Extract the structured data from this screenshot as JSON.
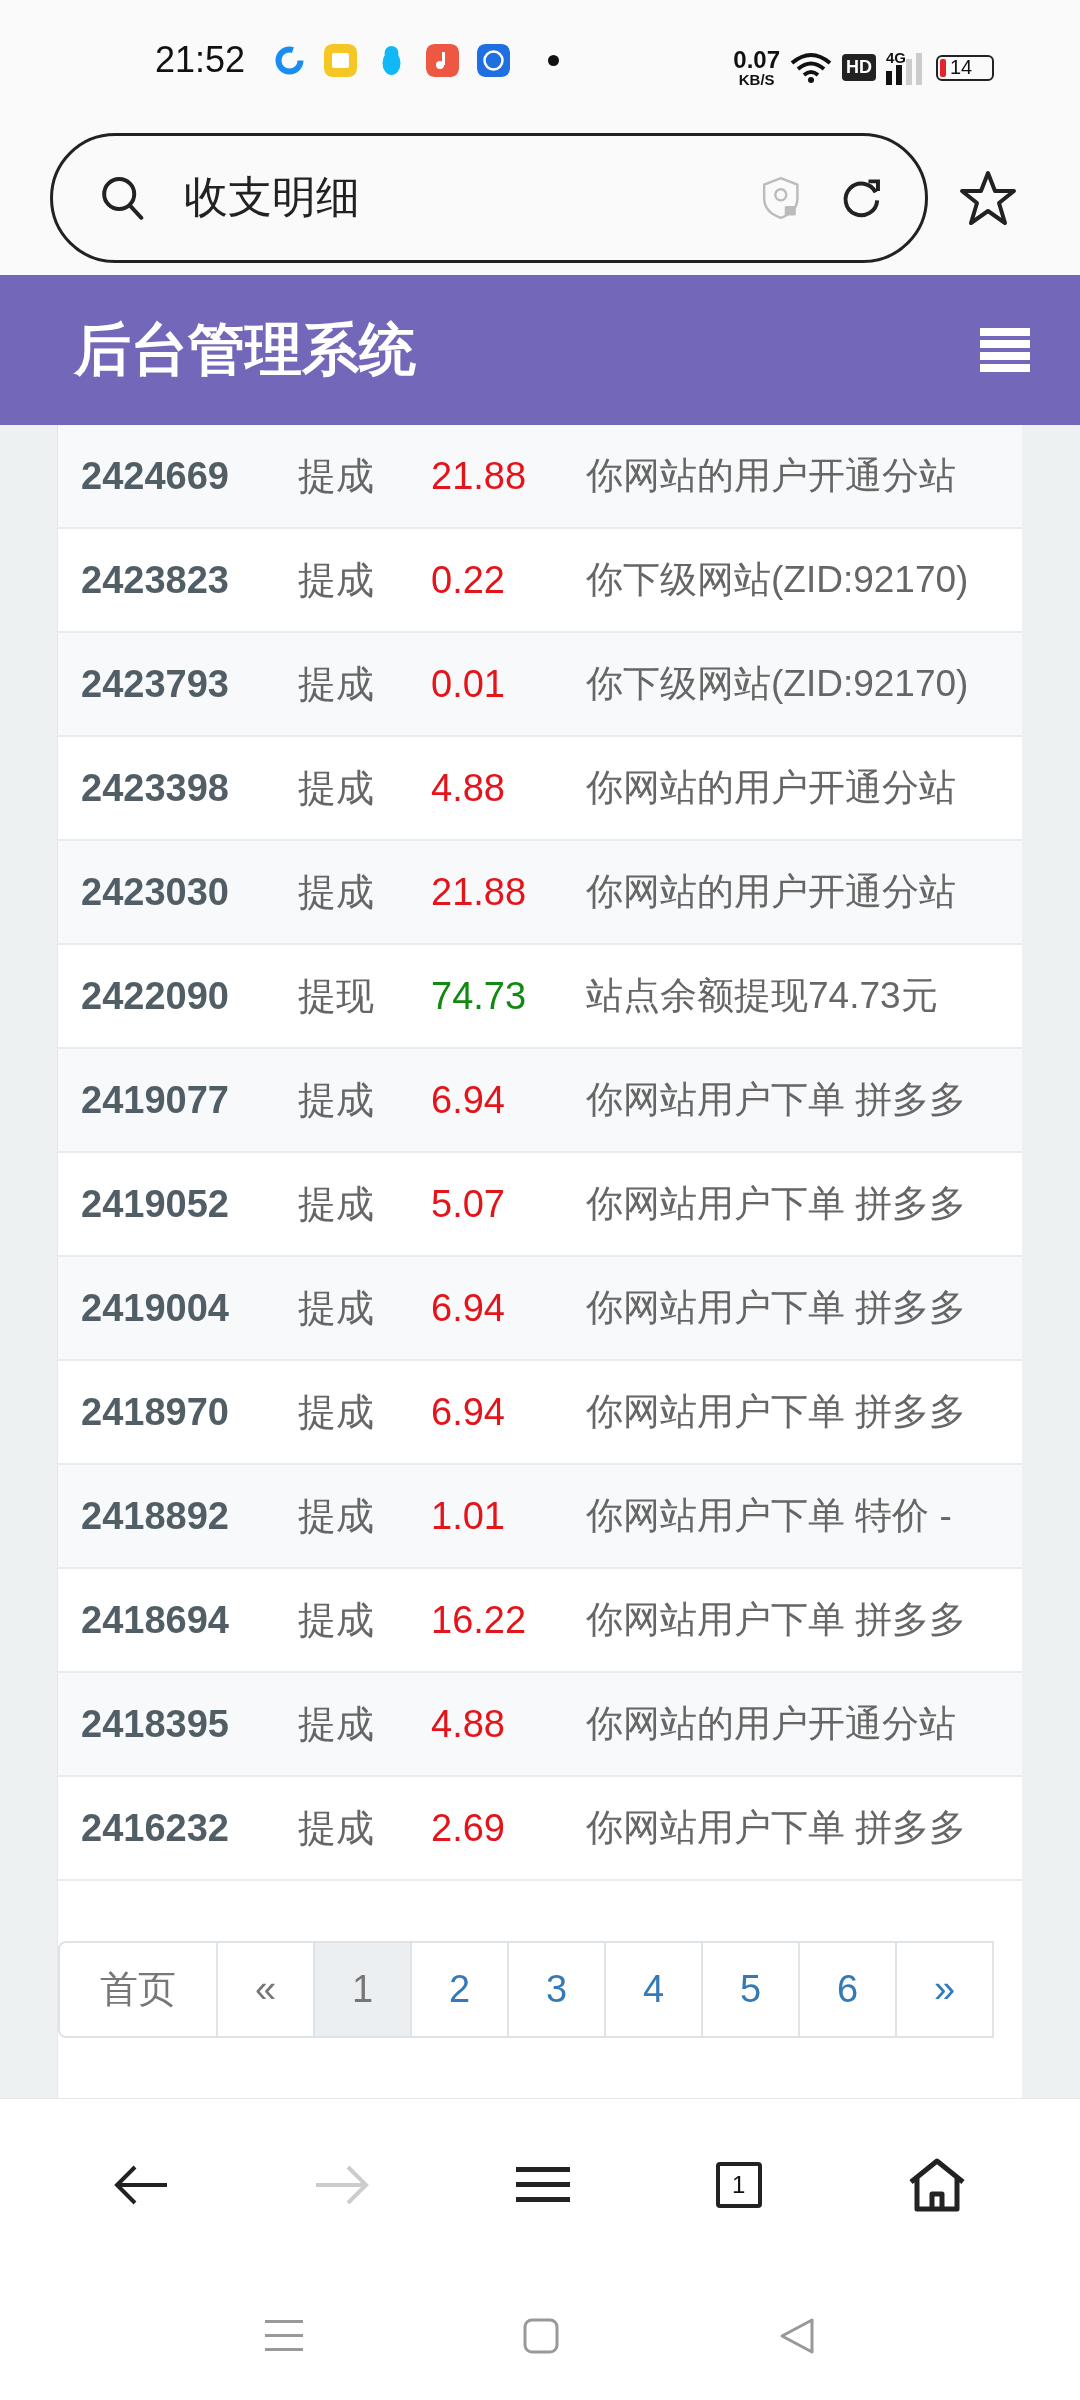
{
  "status_bar": {
    "time": "21:52",
    "net_speed": "0.07",
    "net_unit": "KB/S",
    "network_badge": "HD",
    "network_type": "4G",
    "battery": "14"
  },
  "address_bar": {
    "value": "收支明细"
  },
  "header": {
    "title": "后台管理系统"
  },
  "records": [
    {
      "id": "2424669",
      "type": "提成",
      "amount": "21.88",
      "color": "#e4141b",
      "description": "你网站的用户开通分站"
    },
    {
      "id": "2423823",
      "type": "提成",
      "amount": "0.22",
      "color": "#e4141b",
      "description": "你下级网站(ZID:92170)"
    },
    {
      "id": "2423793",
      "type": "提成",
      "amount": "0.01",
      "color": "#e4141b",
      "description": "你下级网站(ZID:92170)"
    },
    {
      "id": "2423398",
      "type": "提成",
      "amount": "4.88",
      "color": "#e4141b",
      "description": "你网站的用户开通分站"
    },
    {
      "id": "2423030",
      "type": "提成",
      "amount": "21.88",
      "color": "#e4141b",
      "description": "你网站的用户开通分站"
    },
    {
      "id": "2422090",
      "type": "提现",
      "amount": "74.73",
      "color": "#118a11",
      "description": "站点余额提现74.73元"
    },
    {
      "id": "2419077",
      "type": "提成",
      "amount": "6.94",
      "color": "#e4141b",
      "description": "你网站用户下单 拼多多"
    },
    {
      "id": "2419052",
      "type": "提成",
      "amount": "5.07",
      "color": "#e4141b",
      "description": "你网站用户下单 拼多多"
    },
    {
      "id": "2419004",
      "type": "提成",
      "amount": "6.94",
      "color": "#e4141b",
      "description": "你网站用户下单 拼多多"
    },
    {
      "id": "2418970",
      "type": "提成",
      "amount": "6.94",
      "color": "#e4141b",
      "description": "你网站用户下单 拼多多"
    },
    {
      "id": "2418892",
      "type": "提成",
      "amount": "1.01",
      "color": "#e4141b",
      "description": "你网站用户下单 特价 -"
    },
    {
      "id": "2418694",
      "type": "提成",
      "amount": "16.22",
      "color": "#e4141b",
      "description": "你网站用户下单 拼多多"
    },
    {
      "id": "2418395",
      "type": "提成",
      "amount": "4.88",
      "color": "#e4141b",
      "description": "你网站的用户开通分站"
    },
    {
      "id": "2416232",
      "type": "提成",
      "amount": "2.69",
      "color": "#e4141b",
      "description": "你网站用户下单 拼多多"
    }
  ],
  "pagination": [
    {
      "label": "首页",
      "selected": false,
      "disabled": true
    },
    {
      "label": "«",
      "selected": false,
      "disabled": true
    },
    {
      "label": "1",
      "selected": true,
      "disabled": false
    },
    {
      "label": "2",
      "selected": false,
      "disabled": false
    },
    {
      "label": "3",
      "selected": false,
      "disabled": false
    },
    {
      "label": "4",
      "selected": false,
      "disabled": false
    },
    {
      "label": "5",
      "selected": false,
      "disabled": false
    },
    {
      "label": "6",
      "selected": false,
      "disabled": false
    },
    {
      "label": "»",
      "selected": false,
      "disabled": false
    }
  ],
  "browser_nav": {
    "tab_count": "1"
  }
}
